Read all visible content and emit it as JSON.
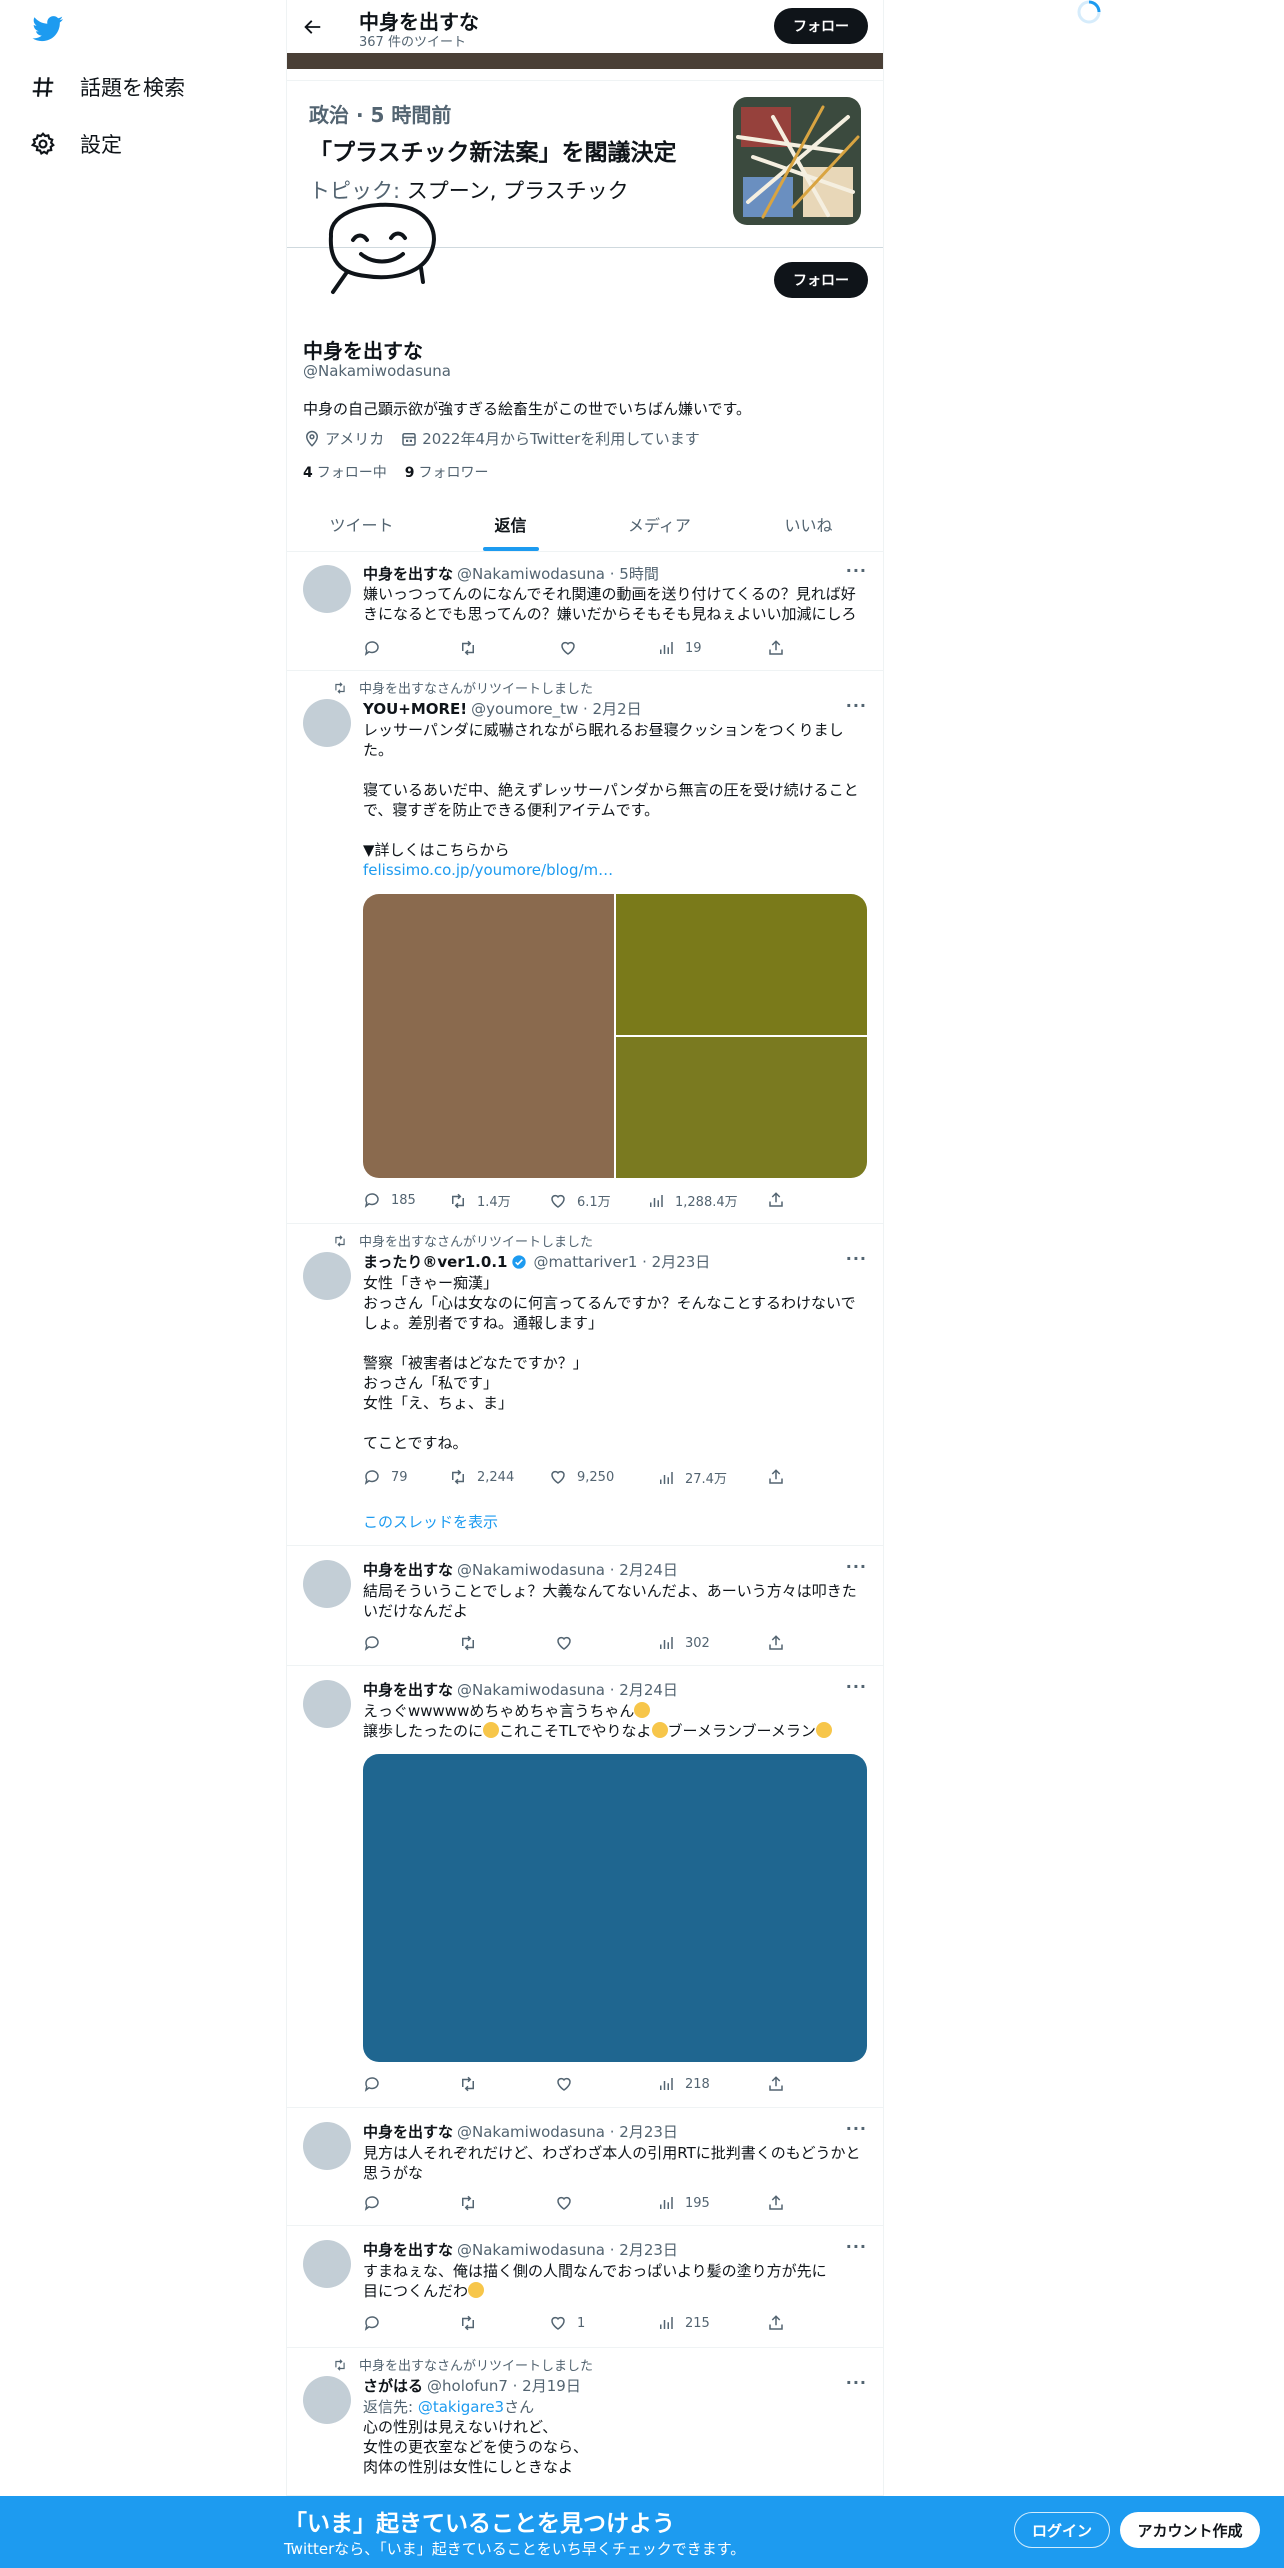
{
  "nav": {
    "explore": "話題を検索",
    "settings": "設定"
  },
  "header": {
    "name": "中身を出すな",
    "tweet_count": "367 件のツイート",
    "follow": "フォロー"
  },
  "trend": {
    "meta": "政治 · 5 時間前",
    "title": "「プラスチック新法案」を閣議決定",
    "topics_label": "トピック:",
    "topics": "スプーン, プラスチック"
  },
  "profile": {
    "follow": "フォロー",
    "name": "中身を出すな",
    "handle": "@Nakamiwodasuna",
    "bio": "中身の自己顕示欲が強すぎる絵畜生がこの世でいちばん嫌いです。",
    "location": "アメリカ",
    "joined": "2022年4月からTwitterを利用しています",
    "following_count": "4",
    "following_label": "フォロー中",
    "followers_count": "9",
    "followers_label": "フォロワー"
  },
  "tabs": [
    "ツイート",
    "返信",
    "メディア",
    "いいね"
  ],
  "tweets": [
    {
      "name": "中身を出すな",
      "handle": "@Nakamiwodasuna · 5時間",
      "text": "嫌いっつってんのになんでそれ関連の動画を送り付けてくるの？見れば好きになるとでも思ってんの？嫌いだからそもそも見ねぇよいい加減にしろ",
      "views": "19"
    },
    {
      "retweeted_by": "中身を出すなさんがリツイートしました",
      "name": "YOU+MORE!",
      "handle": "@youmore_tw · 2月2日",
      "text": "レッサーパンダに威嚇されながら眠れるお昼寝クッションをつくりました。\n\n寝ているあいだ中、絶えずレッサーパンダから無言の圧を受け続けることで、寝すぎを防止できる便利アイテムです。\n\n▼詳しくはこちらから",
      "link": "felissimo.co.jp/youmore/blog/m…",
      "replies": "185",
      "retweets": "1.4万",
      "likes": "6.1万",
      "views": "1,288.4万",
      "media_colors": [
        "#8a6a4e",
        "#7a7a1a",
        "#7a7a20"
      ]
    },
    {
      "retweeted_by": "中身を出すなさんがリツイートしました",
      "name": "まったり®ver1.0.1",
      "handle": "@mattariver1 · 2月23日",
      "text": "女性「きゃー痴漢」\nおっさん「心は女なのに何言ってるんですか？そんなことするわけないでしょ。差別者ですね。通報します」\n\n警察「被害者はどなたですか？」\nおっさん「私です」\n女性「え、ちょ、ま」\n\nてことですね。",
      "replies": "79",
      "retweets": "2,244",
      "likes": "9,250",
      "views": "27.4万",
      "thread": "このスレッドを表示"
    },
    {
      "name": "中身を出すな",
      "handle": "@Nakamiwodasuna · 2月24日",
      "text": "結局そういうことでしょ？大義なんてないんだよ、あーいう方々は叩きたいだけなんだよ",
      "views": "302"
    },
    {
      "name": "中身を出すな",
      "handle": "@Nakamiwodasuna · 2月24日",
      "line1": "えっぐwwwwwめちゃめちゃ言うちゃん",
      "line2a": "譲歩したったのに",
      "line2b": "これこそTLでやりなよ",
      "line2c": "ブーメランブーメラン",
      "views": "218",
      "media_color": "#1f6690"
    },
    {
      "name": "中身を出すな",
      "handle": "@Nakamiwodasuna · 2月23日",
      "text": "見方は人それぞれだけど、わざわざ本人の引用RTに批判書くのもどうかと思うがな",
      "views": "195"
    },
    {
      "name": "中身を出すな",
      "handle": "@Nakamiwodasuna · 2月23日",
      "line1": "すまねぇな、俺は描く側の人間なんでおっぱいより髪の塗り方が先に",
      "line2": "目につくんだわ",
      "likes": "1",
      "views": "215"
    },
    {
      "retweeted_by": "中身を出すなさんがリツイートしました",
      "name": "さがはる",
      "handle": "@holofun7 · 2月19日",
      "reply_label": "返信先:",
      "reply_to": "@takigare3",
      "reply_suffix": "さん",
      "text": "心の性別は見えないけれど、\n女性の更衣室などを使うのなら、\n肉体の性別は女性にしときなよ"
    }
  ],
  "bottom_bar": {
    "title": "「いま」起きていることを見つけよう",
    "subtitle": "Twitterなら、「いま」起きていることをいち早くチェックできます。",
    "login": "ログイン",
    "signup": "アカウント作成"
  },
  "colors": {
    "accent": "#1d9bf0",
    "text": "#0f1419",
    "muted": "#536471"
  }
}
